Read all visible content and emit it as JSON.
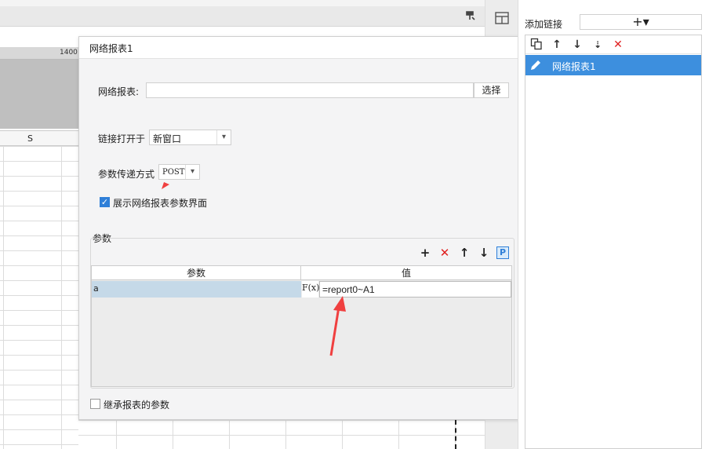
{
  "background": {
    "ruler_label": "1400",
    "column_label": "S"
  },
  "dialog": {
    "title": "网络报表1",
    "report_label": "网络报表:",
    "report_value": "",
    "choose_button": "选择",
    "open_in_label": "链接打开于",
    "open_in_value": "新窗口",
    "pass_method_label": "参数传递方式",
    "pass_method_value": "POST",
    "show_params_label": "展示网络报表参数界面",
    "show_params_checked": true,
    "params_section_label": "参数",
    "table": {
      "headers": [
        "参数",
        "值"
      ],
      "rows": [
        {
          "name": "a",
          "formula_icon": "F(x)",
          "value": "=report0~A1"
        }
      ]
    },
    "inherit_label": "继承报表的参数",
    "inherit_checked": false
  },
  "right_panel": {
    "add_link_label": "添加链接",
    "add_button": "+▾",
    "items": [
      {
        "label": "网络报表1",
        "icon": "pencil-icon",
        "selected": true
      }
    ]
  },
  "colors": {
    "selected_blue": "#3d8fde",
    "delete_red": "#e02020",
    "arrow_red": "#f04040",
    "checkbox_blue": "#2f7fd8",
    "row_highlight": "#c5d9e8"
  }
}
